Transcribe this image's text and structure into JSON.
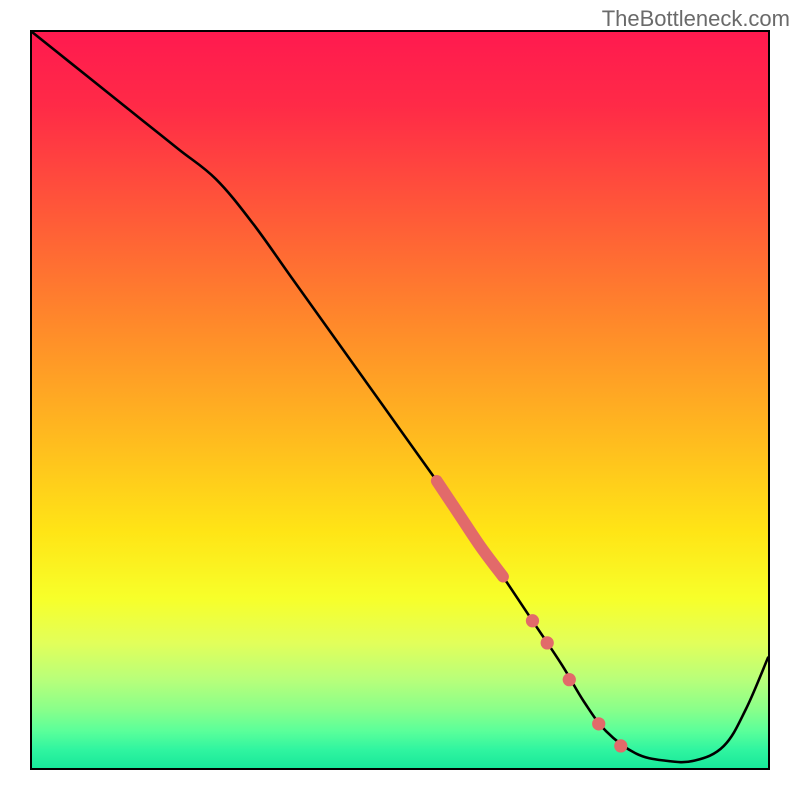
{
  "watermark": "TheBottleneck.com",
  "chart_data": {
    "type": "line",
    "title": "",
    "xlabel": "",
    "ylabel": "",
    "xlim": [
      0,
      100
    ],
    "ylim": [
      0,
      100
    ],
    "grid": false,
    "series": [
      {
        "name": "bottleneck-curve",
        "x": [
          0,
          5,
          10,
          15,
          20,
          25,
          30,
          35,
          40,
          45,
          50,
          55,
          60,
          64,
          68,
          72,
          75,
          78,
          82,
          86,
          90,
          94,
          97,
          100
        ],
        "y": [
          100,
          96,
          92,
          88,
          84,
          80,
          74,
          67,
          60,
          53,
          46,
          39,
          32,
          26,
          20,
          14,
          9,
          5,
          2,
          1,
          1,
          3,
          8,
          15
        ]
      }
    ],
    "highlight_segment": {
      "x": [
        55,
        58,
        61,
        64
      ],
      "y": [
        39,
        34.5,
        30,
        26
      ]
    },
    "dots": [
      {
        "x": 68,
        "y": 20
      },
      {
        "x": 70,
        "y": 17
      },
      {
        "x": 73,
        "y": 12
      },
      {
        "x": 77,
        "y": 6
      },
      {
        "x": 80,
        "y": 3
      }
    ],
    "gradient_stops": [
      {
        "offset": 0,
        "color": "#ff1a4f"
      },
      {
        "offset": 0.1,
        "color": "#ff2a47"
      },
      {
        "offset": 0.25,
        "color": "#ff5a38"
      },
      {
        "offset": 0.4,
        "color": "#ff8a2a"
      },
      {
        "offset": 0.55,
        "color": "#ffba1f"
      },
      {
        "offset": 0.68,
        "color": "#ffe516"
      },
      {
        "offset": 0.77,
        "color": "#f7ff2a"
      },
      {
        "offset": 0.83,
        "color": "#e2ff5a"
      },
      {
        "offset": 0.88,
        "color": "#b8ff7a"
      },
      {
        "offset": 0.92,
        "color": "#8aff8a"
      },
      {
        "offset": 0.95,
        "color": "#5aff9a"
      },
      {
        "offset": 0.975,
        "color": "#30f5a0"
      },
      {
        "offset": 1.0,
        "color": "#18e89a"
      }
    ]
  }
}
